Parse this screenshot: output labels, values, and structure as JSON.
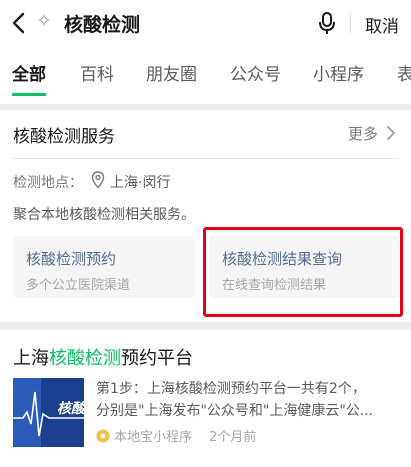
{
  "search": {
    "query": "核酸检测",
    "cancel_label": "取消"
  },
  "tabs": [
    {
      "label": "全部",
      "active": true
    },
    {
      "label": "百科"
    },
    {
      "label": "朋友圈"
    },
    {
      "label": "公众号"
    },
    {
      "label": "小程序"
    },
    {
      "label": "表"
    }
  ],
  "service_card": {
    "title": "核酸检测服务",
    "more_label": "更多",
    "location_label": "检测地点：",
    "location_value": "上海·闵行",
    "description": "聚合本地核酸检测相关服务。",
    "options": [
      {
        "title": "核酸检测预约",
        "subtitle": "多个公立医院渠道"
      },
      {
        "title": "核酸检测结果查询",
        "subtitle": "在线查询检测结果",
        "highlighted": true
      }
    ]
  },
  "result": {
    "title_prefix": "上海",
    "title_highlight": "核酸检测",
    "title_suffix": "预约平台",
    "thumbnail_text": "核酸",
    "snippet_line1": "第1步：上海核酸检测预约平台一共有2个，",
    "snippet_line2": "分别是\"上海发布\"公众号和\"上海健康云\"公...",
    "source": "本地宝小程序",
    "time": "2个月前"
  },
  "colors": {
    "accent_green": "#07c160",
    "link_blue": "#576b95",
    "highlight_red": "#e60012"
  }
}
